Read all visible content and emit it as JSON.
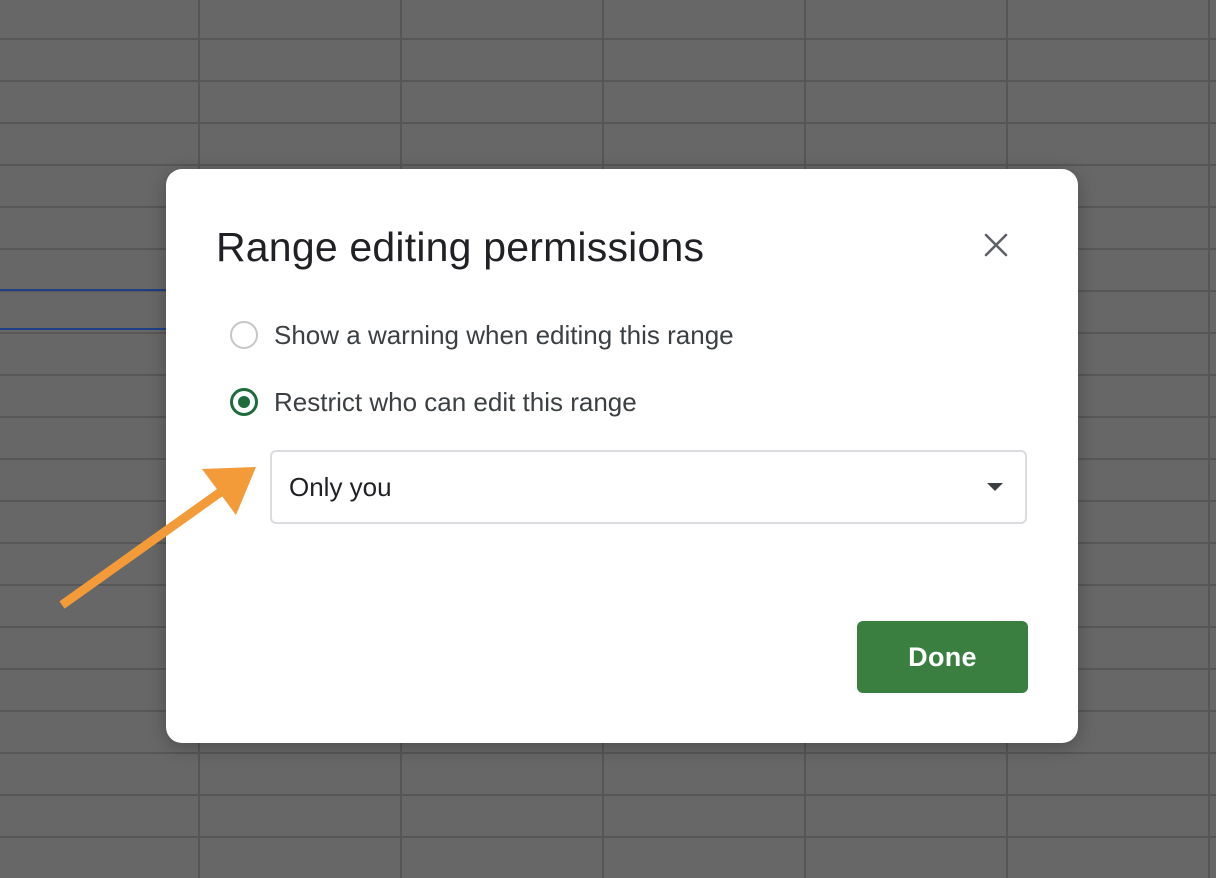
{
  "dialog": {
    "title": "Range editing permissions",
    "close_icon": "close-icon",
    "options": [
      {
        "label": "Show a warning when editing this range",
        "selected": false
      },
      {
        "label": "Restrict who can edit this range",
        "selected": true
      }
    ],
    "editor_select": {
      "value": "Only you"
    },
    "done_label": "Done"
  },
  "colors": {
    "overlay_background": "#676767",
    "primary_button": "#3a7f40",
    "radio_selected": "#1e6b3c",
    "annotation_arrow": "#f29b38",
    "selection_band": "#1f3f86"
  },
  "annotation": {
    "icon": "arrow-icon",
    "points_to": "editor_select"
  }
}
